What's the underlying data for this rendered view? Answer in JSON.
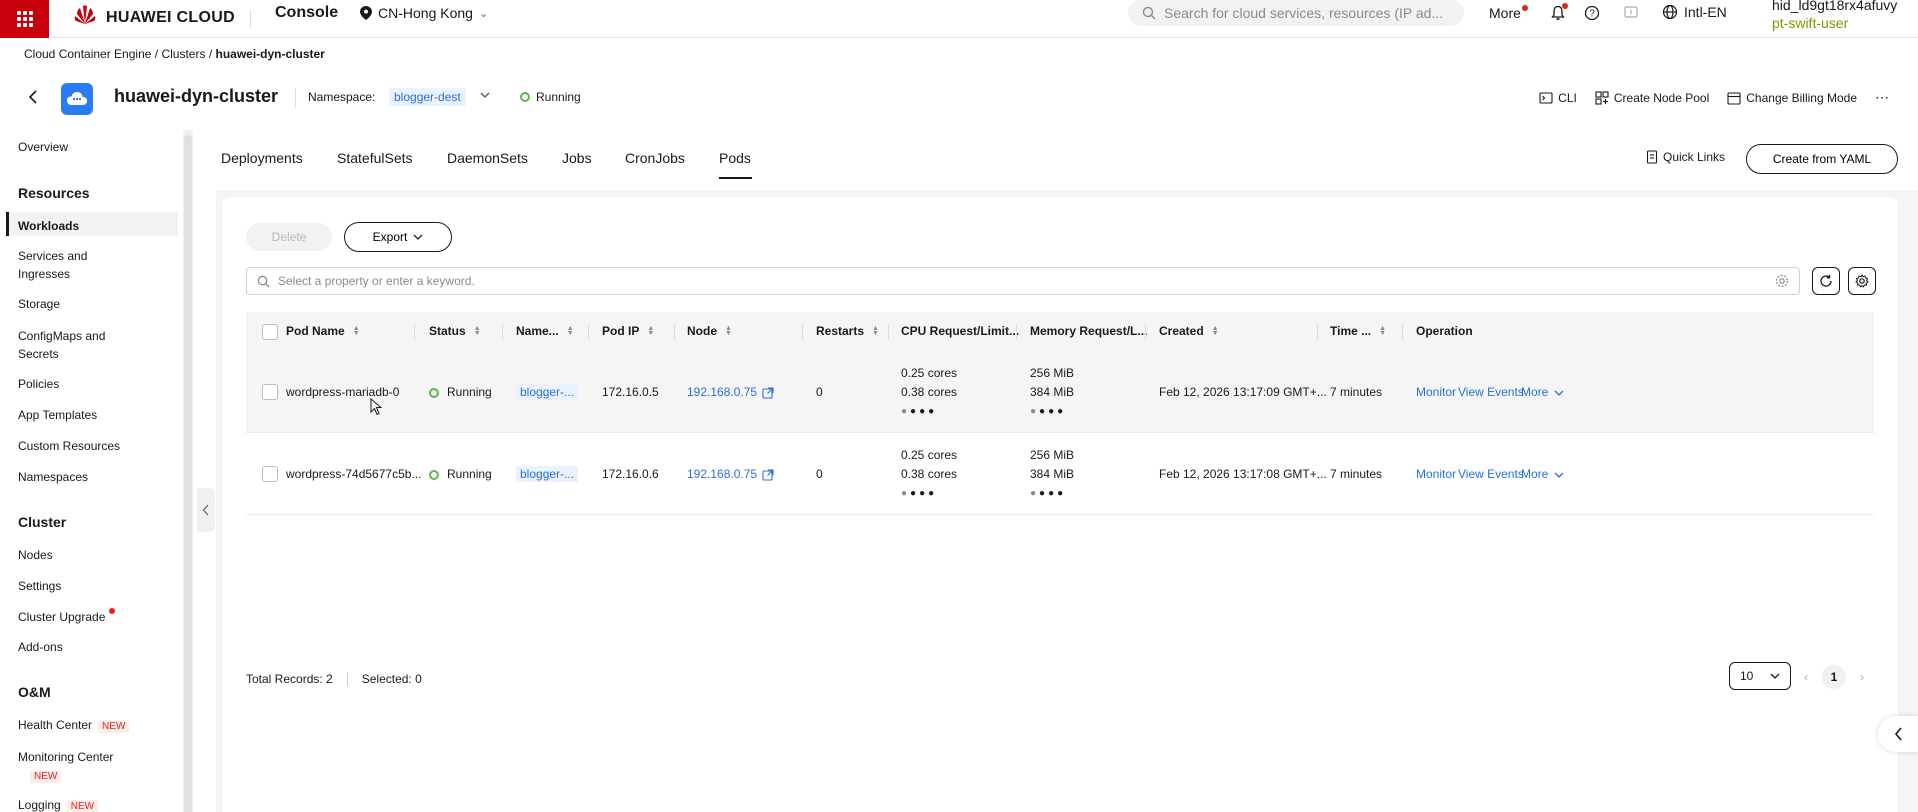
{
  "topbar": {
    "brand": "HUAWEI CLOUD",
    "console": "Console",
    "region": "CN-Hong Kong",
    "search_placeholder": "Search for cloud services, resources (IP ad...",
    "more": "More",
    "lang": "Intl-EN",
    "user_id": "hid_ld9gt18rx4afuvy",
    "user_name": "pt-swift-user"
  },
  "breadcrumb": {
    "items": [
      "Cloud Container Engine",
      "Clusters",
      "huawei-dyn-cluster"
    ],
    "sep": "/"
  },
  "cluster": {
    "name": "huawei-dyn-cluster",
    "namespace_label": "Namespace:",
    "namespace": "blogger-dest",
    "status": "Running",
    "actions": [
      "CLI",
      "Create Node Pool",
      "Change Billing Mode"
    ]
  },
  "sidebar": {
    "overview": "Overview",
    "groups": {
      "resources": "Resources",
      "cluster": "Cluster",
      "om": "O&M"
    },
    "items": {
      "workloads": "Workloads",
      "services_1": "Services and",
      "services_2": "Ingresses",
      "storage": "Storage",
      "configmaps_1": "ConfigMaps and",
      "configmaps_2": "Secrets",
      "policies": "Policies",
      "app_templates": "App Templates",
      "custom_resources": "Custom Resources",
      "namespaces": "Namespaces",
      "nodes": "Nodes",
      "settings": "Settings",
      "cluster_upgrade": "Cluster Upgrade",
      "addons": "Add-ons",
      "health_center": "Health Center",
      "monitoring_center": "Monitoring Center",
      "logging": "Logging"
    },
    "new_tag": "NEW"
  },
  "tabs": [
    "Deployments",
    "StatefulSets",
    "DaemonSets",
    "Jobs",
    "CronJobs",
    "Pods"
  ],
  "active_tab": "Pods",
  "quick_links": "Quick Links",
  "create_yaml": "Create from YAML",
  "toolbar": {
    "delete": "Delete",
    "export": "Export",
    "filter_placeholder": "Select a property or enter a keyword."
  },
  "table": {
    "headers": [
      "Pod Name",
      "Status",
      "Name...",
      "Pod IP",
      "Node",
      "Restarts",
      "CPU Request/Limit...",
      "Memory Request/L...",
      "Created",
      "Time ...",
      "Operation"
    ],
    "rows": [
      {
        "pod_name": "wordpress-mariadb-0",
        "status": "Running",
        "namespace": "blogger-...",
        "pod_ip": "172.16.0.5",
        "node": "192.168.0.75",
        "restarts": "0",
        "cpu_req": "0.25 cores",
        "cpu_lim": "0.38 cores",
        "mem_req": "256 MiB",
        "mem_lim": "384 MiB",
        "created": "Feb 12, 2026 13:17:09 GMT+...",
        "time": "7 minutes"
      },
      {
        "pod_name": "wordpress-74d5677c5b...",
        "status": "Running",
        "namespace": "blogger-...",
        "pod_ip": "172.16.0.6",
        "node": "192.168.0.75",
        "restarts": "0",
        "cpu_req": "0.25 cores",
        "cpu_lim": "0.38 cores",
        "mem_req": "256 MiB",
        "mem_lim": "384 MiB",
        "created": "Feb 12, 2026 13:17:08 GMT+...",
        "time": "7 minutes"
      }
    ],
    "ops": [
      "Monitor",
      "View Events",
      "More"
    ]
  },
  "footer": {
    "total": "Total Records: 2",
    "selected": "Selected: 0",
    "page_size": "10",
    "current_page": "1"
  },
  "colors": {
    "brand_red": "#c7000b",
    "link_blue": "#2a6fdb",
    "running_green": "#5db846"
  }
}
